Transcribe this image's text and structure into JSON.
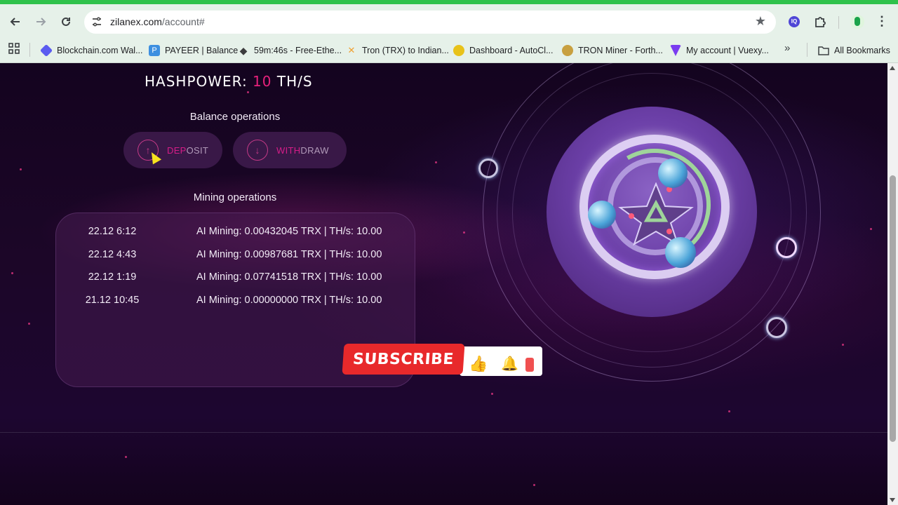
{
  "browser": {
    "url_domain": "zilanex.com",
    "url_path": "/account#",
    "icons": {
      "back": "arrow-left-icon",
      "forward": "arrow-right-icon",
      "reload": "reload-icon",
      "site_info": "tune-icon",
      "bookmark_star": "star-icon",
      "extension_badge": "extension-badge-icon",
      "extensions": "puzzle-icon",
      "profile": "profile-avatar",
      "menu": "kebab-menu-icon"
    },
    "extension_badge_text": "IQ"
  },
  "bookmarks": {
    "items": [
      {
        "label": "Blockchain.com Wal...",
        "color": "#5b5cf0"
      },
      {
        "label": "PAYEER | Balance",
        "color": "#3d8fe0"
      },
      {
        "label": "59m:46s - Free-Ethe...",
        "color": "#3c3c3d"
      },
      {
        "label": "Tron (TRX) to Indian...",
        "color": "#f0a030"
      },
      {
        "label": "Dashboard - AutoCl...",
        "color": "#e8c21a"
      },
      {
        "label": "TRON Miner - Forth...",
        "color": "#c8a040"
      },
      {
        "label": "My account | Vuexy...",
        "color": "#7a3cf0"
      }
    ],
    "more_label": "»",
    "all_bookmarks": "All Bookmarks"
  },
  "page": {
    "hashpower_label": "HASHPOWER: ",
    "hashpower_value": "10",
    "hashpower_unit": " TH/S",
    "balance_title": "Balance operations",
    "deposit_hl": "DEP",
    "deposit_rest": "OSIT",
    "withdraw_hl": "WITH",
    "withdraw_rest": "DRAW",
    "mining_title": "Mining operations",
    "mining_ops": [
      {
        "time": "22.12 6:12",
        "text": "AI Mining: 0.00432045 TRX | TH/s: 10.00"
      },
      {
        "time": "22.12 4:43",
        "text": "AI Mining: 0.00987681 TRX | TH/s: 10.00"
      },
      {
        "time": "22.12 1:19",
        "text": "AI Mining: 0.07741518 TRX | TH/s: 10.00"
      },
      {
        "time": "21.12 10:45",
        "text": "AI Mining: 0.00000000 TRX | TH/s: 10.00"
      }
    ]
  },
  "overlay": {
    "subscribe_label": "SUBSCRIBE"
  },
  "colors": {
    "accent_pink": "#e6217b",
    "browser_green": "#2fc24b",
    "subscribe_red": "#e8292b"
  }
}
